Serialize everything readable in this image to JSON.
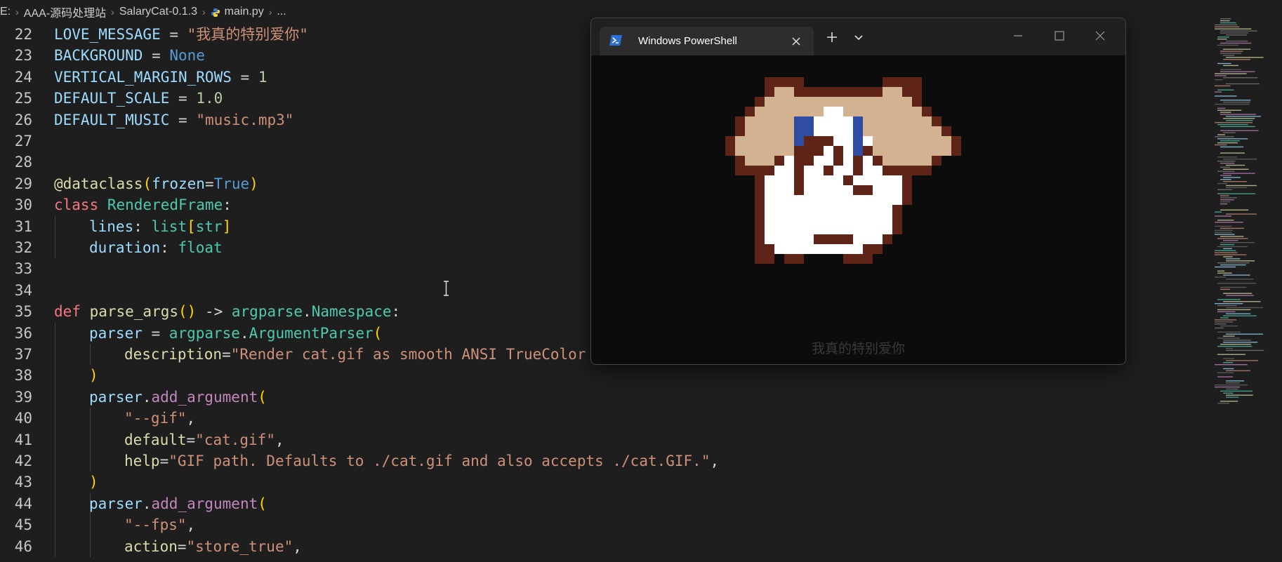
{
  "breadcrumb": [
    "E:",
    "AAA-源码处理站",
    "SalaryCat-0.1.3",
    "main.py",
    "..."
  ],
  "editor": {
    "lines": [
      {
        "num": "22",
        "indent": 0,
        "tokens": [
          [
            "cw",
            "LOVE_MESSAGE"
          ],
          [
            "cp",
            " = "
          ],
          [
            "cs",
            "\"我真的特别爱你\""
          ]
        ]
      },
      {
        "num": "23",
        "indent": 0,
        "tokens": [
          [
            "cw",
            "BACKGROUND"
          ],
          [
            "cp",
            " = "
          ],
          [
            "cc",
            "None"
          ]
        ]
      },
      {
        "num": "24",
        "indent": 0,
        "tokens": [
          [
            "cw",
            "VERTICAL_MARGIN_ROWS"
          ],
          [
            "cp",
            " = "
          ],
          [
            "cn",
            "1"
          ]
        ]
      },
      {
        "num": "25",
        "indent": 0,
        "tokens": [
          [
            "cw",
            "DEFAULT_SCALE"
          ],
          [
            "cp",
            " = "
          ],
          [
            "cn",
            "1.0"
          ]
        ]
      },
      {
        "num": "26",
        "indent": 0,
        "tokens": [
          [
            "cw",
            "DEFAULT_MUSIC"
          ],
          [
            "cp",
            " = "
          ],
          [
            "cs",
            "\"music.mp3\""
          ]
        ]
      },
      {
        "num": "27",
        "indent": 0,
        "tokens": []
      },
      {
        "num": "28",
        "indent": 0,
        "tokens": []
      },
      {
        "num": "29",
        "indent": 0,
        "tokens": [
          [
            "cf",
            "@dataclass"
          ],
          [
            "cb1",
            "("
          ],
          [
            "cw",
            "frozen"
          ],
          [
            "cp",
            "="
          ],
          [
            "cc",
            "True"
          ],
          [
            "cb1",
            ")"
          ]
        ]
      },
      {
        "num": "30",
        "indent": 0,
        "tokens": [
          [
            "ck",
            "class "
          ],
          [
            "ct",
            "RenderedFrame"
          ],
          [
            "cp",
            ":"
          ]
        ]
      },
      {
        "num": "31",
        "indent": 1,
        "tokens": [
          [
            "cw",
            "lines"
          ],
          [
            "cp",
            ": "
          ],
          [
            "ct",
            "list"
          ],
          [
            "cb1",
            "["
          ],
          [
            "ct",
            "str"
          ],
          [
            "cb1",
            "]"
          ]
        ]
      },
      {
        "num": "32",
        "indent": 1,
        "tokens": [
          [
            "cw",
            "duration"
          ],
          [
            "cp",
            ": "
          ],
          [
            "ct",
            "float"
          ]
        ]
      },
      {
        "num": "33",
        "indent": 0,
        "tokens": []
      },
      {
        "num": "34",
        "indent": 0,
        "tokens": []
      },
      {
        "num": "35",
        "indent": 0,
        "tokens": [
          [
            "ck",
            "def "
          ],
          [
            "cf",
            "parse_args"
          ],
          [
            "cb1",
            "()"
          ],
          [
            "cp",
            " -> "
          ],
          [
            "ct",
            "argparse"
          ],
          [
            "cp",
            "."
          ],
          [
            "ct",
            "Namespace"
          ],
          [
            "cp",
            ":"
          ]
        ]
      },
      {
        "num": "36",
        "indent": 1,
        "tokens": [
          [
            "cw",
            "parser"
          ],
          [
            "cp",
            " = "
          ],
          [
            "ct",
            "argparse"
          ],
          [
            "cp",
            "."
          ],
          [
            "ct",
            "ArgumentParser"
          ],
          [
            "cb1",
            "("
          ]
        ]
      },
      {
        "num": "37",
        "indent": 2,
        "tokens": [
          [
            "cf",
            "description"
          ],
          [
            "cp",
            "="
          ],
          [
            "cs",
            "\"Render cat.gif as smooth ANSI TrueColor"
          ]
        ]
      },
      {
        "num": "38",
        "indent": 1,
        "tokens": [
          [
            "cb1",
            ")"
          ]
        ]
      },
      {
        "num": "39",
        "indent": 1,
        "tokens": [
          [
            "cw",
            "parser"
          ],
          [
            "cp",
            "."
          ],
          [
            "cd",
            "add_argument"
          ],
          [
            "cb1",
            "("
          ]
        ]
      },
      {
        "num": "40",
        "indent": 2,
        "tokens": [
          [
            "cs",
            "\"--gif\""
          ],
          [
            "cp",
            ","
          ]
        ]
      },
      {
        "num": "41",
        "indent": 2,
        "tokens": [
          [
            "cf",
            "default"
          ],
          [
            "cp",
            "="
          ],
          [
            "cs",
            "\"cat.gif\""
          ],
          [
            "cp",
            ","
          ]
        ]
      },
      {
        "num": "42",
        "indent": 2,
        "tokens": [
          [
            "cf",
            "help"
          ],
          [
            "cp",
            "="
          ],
          [
            "cs",
            "\"GIF path. Defaults to ./cat.gif and also accepts ./cat.GIF.\""
          ],
          [
            "cp",
            ","
          ]
        ]
      },
      {
        "num": "43",
        "indent": 1,
        "tokens": [
          [
            "cb1",
            ")"
          ]
        ]
      },
      {
        "num": "44",
        "indent": 1,
        "tokens": [
          [
            "cw",
            "parser"
          ],
          [
            "cp",
            "."
          ],
          [
            "cd",
            "add_argument"
          ],
          [
            "cb1",
            "("
          ]
        ]
      },
      {
        "num": "45",
        "indent": 2,
        "tokens": [
          [
            "cs",
            "\"--fps\""
          ],
          [
            "cp",
            ","
          ]
        ]
      },
      {
        "num": "46",
        "indent": 2,
        "tokens": [
          [
            "cf",
            "action"
          ],
          [
            "cp",
            "="
          ],
          [
            "cs",
            "\"store_true\""
          ],
          [
            "cp",
            ","
          ]
        ]
      }
    ]
  },
  "terminal": {
    "tab_title": "Windows PowerShell",
    "output_text": "我真的特别爱你",
    "icons": {
      "tab": "powershell-icon",
      "tab_close": "close-icon",
      "new_tab": "plus-icon",
      "dropdown": "chevron-down-icon",
      "minimize": "minimize-icon",
      "maximize": "maximize-icon",
      "close": "close-icon"
    }
  },
  "colors": {
    "editor_bg": "#1e1e1e",
    "terminal_bg": "#0c0c0c",
    "cat_dark_brown": "#5e2418",
    "cat_tan": "#d2b290",
    "cat_white": "#ffffff",
    "cat_blue": "#2f4ea3"
  }
}
